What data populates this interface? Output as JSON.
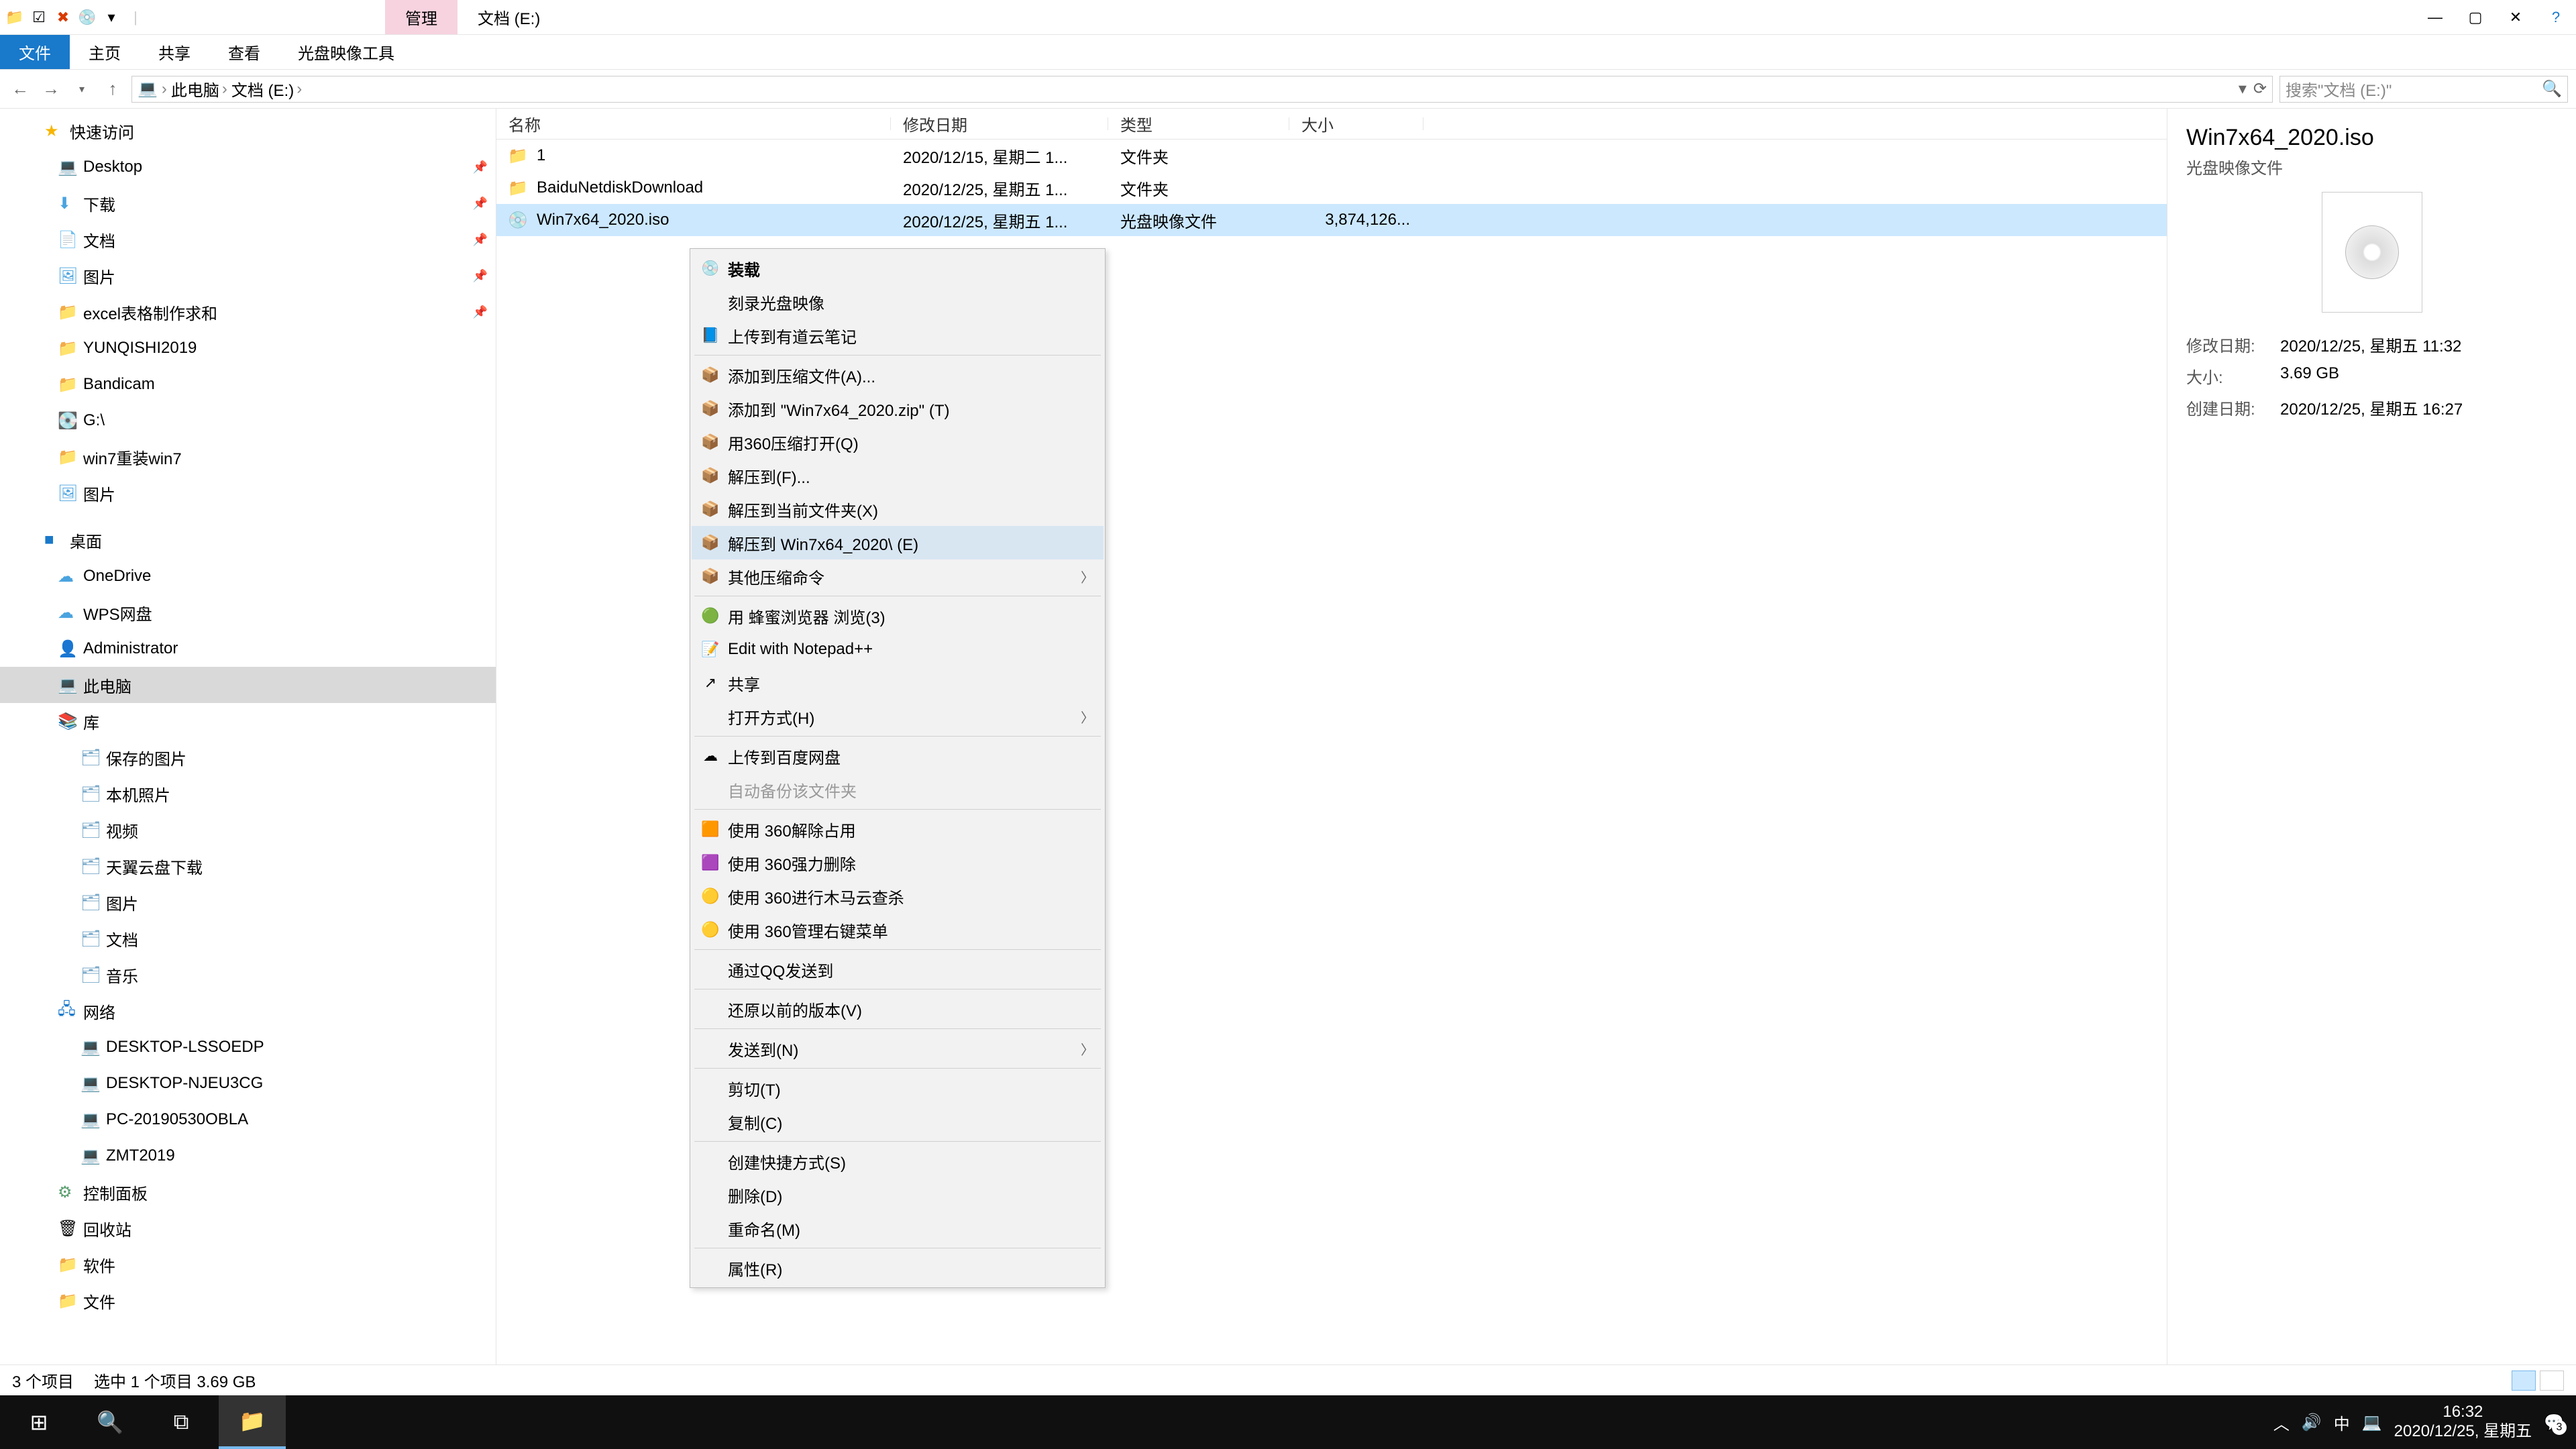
{
  "title_tabs": {
    "manage": "管理",
    "location": "文档 (E:)"
  },
  "window": {
    "help_tip": "?"
  },
  "ribbon": {
    "file": "文件",
    "home": "主页",
    "share": "共享",
    "view": "查看",
    "disc_tools": "光盘映像工具"
  },
  "nav": {
    "breadcrumbs": [
      "此电脑",
      "文档 (E:)"
    ],
    "search_placeholder": "搜索\"文档 (E:)\""
  },
  "tree": {
    "quick": "快速访问",
    "items_quick": [
      "Desktop",
      "下载",
      "文档",
      "图片",
      "excel表格制作求和",
      "YUNQISHI2019",
      "Bandicam",
      "G:\\",
      "win7重装win7",
      "图片"
    ],
    "desktop": "桌面",
    "items_desktop": [
      "OneDrive",
      "WPS网盘",
      "Administrator",
      "此电脑",
      "库"
    ],
    "lib_items": [
      "保存的图片",
      "本机照片",
      "视频",
      "天翼云盘下载",
      "图片",
      "文档",
      "音乐"
    ],
    "network": "网络",
    "net_items": [
      "DESKTOP-LSSOEDP",
      "DESKTOP-NJEU3CG",
      "PC-20190530OBLA",
      "ZMT2019"
    ],
    "ctrl": "控制面板",
    "recycle": "回收站",
    "soft": "软件",
    "files": "文件"
  },
  "cols": {
    "name": "名称",
    "date": "修改日期",
    "type": "类型",
    "size": "大小"
  },
  "rows": [
    {
      "name": "1",
      "date": "2020/12/15, 星期二 1...",
      "type": "文件夹",
      "size": "",
      "icon": "folder"
    },
    {
      "name": "BaiduNetdiskDownload",
      "date": "2020/12/25, 星期五 1...",
      "type": "文件夹",
      "size": "",
      "icon": "folder"
    },
    {
      "name": "Win7x64_2020.iso",
      "date": "2020/12/25, 星期五 1...",
      "type": "光盘映像文件",
      "size": "3,874,126...",
      "icon": "disc"
    }
  ],
  "details": {
    "title": "Win7x64_2020.iso",
    "subtitle": "光盘映像文件",
    "mod_label": "修改日期:",
    "mod_val": "2020/12/25, 星期五 11:32",
    "size_label": "大小:",
    "size_val": "3.69 GB",
    "create_label": "创建日期:",
    "create_val": "2020/12/25, 星期五 16:27"
  },
  "ctx": [
    {
      "t": "item",
      "label": "装载",
      "icon": "💿",
      "bold": true
    },
    {
      "t": "item",
      "label": "刻录光盘映像"
    },
    {
      "t": "item",
      "label": "上传到有道云笔记",
      "icon": "📘"
    },
    {
      "t": "sep"
    },
    {
      "t": "item",
      "label": "添加到压缩文件(A)...",
      "icon": "📦"
    },
    {
      "t": "item",
      "label": "添加到 \"Win7x64_2020.zip\" (T)",
      "icon": "📦"
    },
    {
      "t": "item",
      "label": "用360压缩打开(Q)",
      "icon": "📦"
    },
    {
      "t": "item",
      "label": "解压到(F)...",
      "icon": "📦"
    },
    {
      "t": "item",
      "label": "解压到当前文件夹(X)",
      "icon": "📦"
    },
    {
      "t": "item",
      "label": "解压到 Win7x64_2020\\ (E)",
      "icon": "📦",
      "hl": true
    },
    {
      "t": "item",
      "label": "其他压缩命令",
      "icon": "📦",
      "sub": true
    },
    {
      "t": "sep"
    },
    {
      "t": "item",
      "label": "用 蜂蜜浏览器 浏览(3)",
      "icon": "🟢"
    },
    {
      "t": "item",
      "label": "Edit with Notepad++",
      "icon": "📝"
    },
    {
      "t": "item",
      "label": "共享",
      "icon": "↗"
    },
    {
      "t": "item",
      "label": "打开方式(H)",
      "sub": true
    },
    {
      "t": "sep"
    },
    {
      "t": "item",
      "label": "上传到百度网盘",
      "icon": "☁"
    },
    {
      "t": "item",
      "label": "自动备份该文件夹",
      "dis": true
    },
    {
      "t": "sep"
    },
    {
      "t": "item",
      "label": "使用 360解除占用",
      "icon": "🟧"
    },
    {
      "t": "item",
      "label": "使用 360强力删除",
      "icon": "🟪"
    },
    {
      "t": "item",
      "label": "使用 360进行木马云查杀",
      "icon": "🟡"
    },
    {
      "t": "item",
      "label": "使用 360管理右键菜单",
      "icon": "🟡"
    },
    {
      "t": "sep"
    },
    {
      "t": "item",
      "label": "通过QQ发送到"
    },
    {
      "t": "sep"
    },
    {
      "t": "item",
      "label": "还原以前的版本(V)"
    },
    {
      "t": "sep"
    },
    {
      "t": "item",
      "label": "发送到(N)",
      "sub": true
    },
    {
      "t": "sep"
    },
    {
      "t": "item",
      "label": "剪切(T)"
    },
    {
      "t": "item",
      "label": "复制(C)"
    },
    {
      "t": "sep"
    },
    {
      "t": "item",
      "label": "创建快捷方式(S)"
    },
    {
      "t": "item",
      "label": "删除(D)"
    },
    {
      "t": "item",
      "label": "重命名(M)"
    },
    {
      "t": "sep"
    },
    {
      "t": "item",
      "label": "属性(R)"
    }
  ],
  "status": {
    "count": "3 个项目",
    "sel": "选中 1 个项目  3.69 GB"
  },
  "taskbar": {
    "ime": "中",
    "time": "16:32",
    "date": "2020/12/25, 星期五",
    "badge": "3"
  }
}
